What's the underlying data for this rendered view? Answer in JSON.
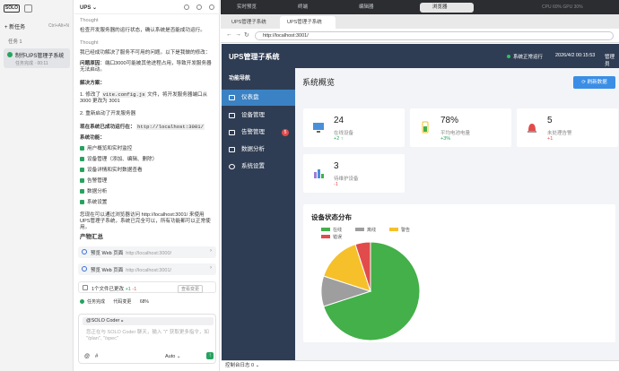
{
  "app": {
    "logo": "SOLO",
    "new_task": "+ 新任务",
    "new_task_shortcut": "Ctrl+Alt+N",
    "tasks_label": "任务 1"
  },
  "task": {
    "title": "制作UPS管理子系统",
    "sub": "任务完成 · 00:11"
  },
  "chat": {
    "title": "UPS ⌄",
    "thought1": "Thought",
    "l1": "检查开发服务器的运行状态，确认系统是否能成功运行。",
    "thought2": "Thought",
    "l2": "我已经成功解决了服务不可用的问题。以下是我做的修改：",
    "l3b": "问题原因",
    "l3": "：端口3000可能被其他进程占用，导致开发服务器无法启动。",
    "sol": "解决方案：",
    "s1a": "1. 修改了 ",
    "s1code": "vite.config.js",
    "s1b": " 文件，将开发服务器端口从 3000 更改为 3001",
    "s2": "2. 重新启动了开发服务器",
    "now": "现在系统已成功运行在：",
    "nowurl": "http://localhost:3001/",
    "feat": "系统功能：",
    "features": [
      "用户概览和实时监控",
      "设备管理（添加、编辑、删除）",
      "设备详情和实时数据查看",
      "告警管理",
      "数据分析",
      "系统设置"
    ],
    "tail": "您现在可以通过浏览器访问 http://localhost:3001/ 来使用UPS管理子系统，系统已完全可以，所有功能都可以正常使用。",
    "summary": "产物汇总",
    "card1": "预览 Web 页面",
    "card1url": "http://localhost:3000/",
    "card2": "预览 Web 页面",
    "card2url": "http://localhost:3001/",
    "files": "1个文件已更改",
    "plus": "+1",
    "minus": "-1",
    "view": "查看变更",
    "done": "任务完成",
    "tokens": "代码变更",
    "pct": "68%",
    "agent": "@SOLO Coder 𝄪",
    "placeholder": "您正在与 SOLO Coder 聊天，输入 \"/\" 获取更多指令，如 \"/plan\", \"/spec\"",
    "mode": "Auto ⌄"
  },
  "topbar": {
    "tabs": [
      "实时预览",
      "终端",
      "编辑器",
      "浏览器"
    ],
    "right": "CPU 60%   GPU 30%"
  },
  "browser": {
    "tab1": "UPS管理子系统",
    "tab2": "UPS管理子系统",
    "url": "http://localhost:3001/"
  },
  "ups": {
    "title": "UPS管理子系统",
    "status": "系统正常运行",
    "time": "2026/4/2 00:15:53",
    "user": "管理员",
    "nav_title": "功能导航",
    "nav": [
      "仪表盘",
      "设备管理",
      "告警管理",
      "数据分析",
      "系统设置"
    ],
    "alarm_badge": "5",
    "page_title": "系统概览",
    "refresh": "刷新数据",
    "stats": [
      {
        "value": "24",
        "label": "在线设备",
        "delta": "+2 ↑",
        "color": "#27a35f"
      },
      {
        "value": "78%",
        "label": "平均电池电量",
        "delta": "+3%",
        "color": "#27a35f"
      },
      {
        "value": "5",
        "label": "未处理告警",
        "delta": "+1",
        "color": "#e24b4b"
      },
      {
        "value": "3",
        "label": "待维护设备",
        "delta": "-1",
        "color": "#e24b4b"
      }
    ],
    "chart_title": "设备状态分布",
    "log": "控制台日志 0 ⌄"
  },
  "chart_data": {
    "type": "pie",
    "title": "设备状态分布",
    "categories": [
      "在线",
      "离线",
      "警告",
      "错误"
    ],
    "values": [
      70,
      10,
      15,
      5
    ],
    "colors": [
      "#43b049",
      "#9e9e9e",
      "#f5c02a",
      "#e24b4b"
    ],
    "legend": "top"
  }
}
